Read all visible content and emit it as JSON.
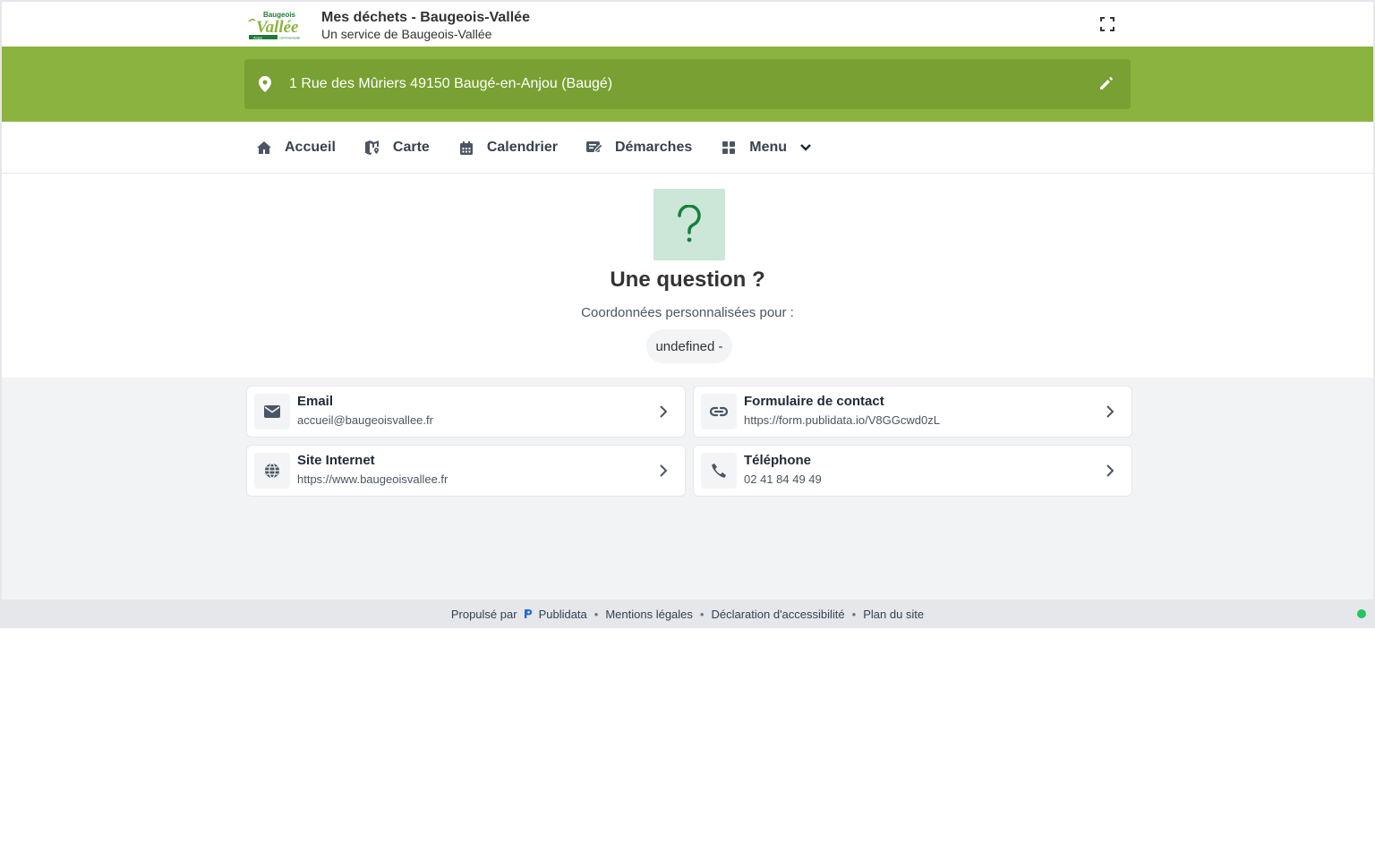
{
  "header": {
    "logo_text_top": "Baugeois",
    "logo_text_main": "Vallée",
    "logo_text_tag_left": "Anjou",
    "logo_text_tag_right": "communauté",
    "title": "Mes déchets - Baugeois-Vallée",
    "subtitle": "Un service de Baugeois-Vallée",
    "fullscreen_icon": "fullscreen-icon"
  },
  "address": {
    "text": "1 Rue des Mûriers 49150 Baugé-en-Anjou (Baugé)",
    "pin_icon": "location-pin-icon",
    "edit_icon": "pencil-icon"
  },
  "nav": {
    "items": [
      {
        "label": "Accueil",
        "icon": "home-icon"
      },
      {
        "label": "Carte",
        "icon": "map-icon"
      },
      {
        "label": "Calendrier",
        "icon": "calendar-icon"
      },
      {
        "label": "Démarches",
        "icon": "form-edit-icon"
      },
      {
        "label": "Menu",
        "icon": "grid-icon"
      }
    ]
  },
  "question": {
    "title": "Une question ?",
    "subtitle": "Coordonnées personnalisées pour :",
    "chip": "undefined -"
  },
  "contacts": [
    {
      "label": "Email",
      "value": "accueil@baugeoisvallee.fr",
      "icon": "envelope-icon"
    },
    {
      "label": "Formulaire de contact",
      "value": "https://form.publidata.io/V8GGcwd0zL",
      "icon": "link-icon"
    },
    {
      "label": "Site Internet",
      "value": "https://www.baugeoisvallee.fr",
      "icon": "globe-icon"
    },
    {
      "label": "Téléphone",
      "value": "02 41 84 49 49",
      "icon": "phone-icon"
    }
  ],
  "footer": {
    "powered_by": "Propulsé par",
    "brand": "Publidata",
    "links": [
      "Mentions légales",
      "Déclaration d'accessibilité",
      "Plan du site"
    ],
    "separator": "•"
  },
  "colors": {
    "brand_green": "#8bb33f",
    "address_box": "#78a032",
    "question_icon_bg": "#cce6d8",
    "question_icon_fg": "#15803d",
    "status_dot": "#22c55e"
  }
}
